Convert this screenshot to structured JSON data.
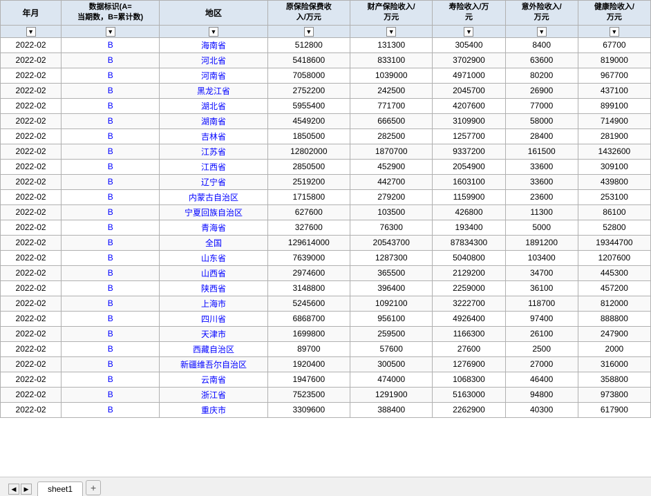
{
  "headers": {
    "year_month": "年月",
    "data_flag": "数据标识(A=当期数，B=累计数)",
    "region": "地区",
    "col1": "原保险保费收入/万元",
    "col2": "财产保险收入/万元",
    "col3": "寿险收入/万元",
    "col4": "意外险收入/万元",
    "col5": "健康险收入/万元"
  },
  "rows": [
    {
      "ym": "2022-02",
      "flag": "B",
      "region": "海南省",
      "c1": "512800",
      "c2": "131300",
      "c3": "305400",
      "c4": "8400",
      "c5": "67700"
    },
    {
      "ym": "2022-02",
      "flag": "B",
      "region": "河北省",
      "c1": "5418600",
      "c2": "833100",
      "c3": "3702900",
      "c4": "63600",
      "c5": "819000"
    },
    {
      "ym": "2022-02",
      "flag": "B",
      "region": "河南省",
      "c1": "7058000",
      "c2": "1039000",
      "c3": "4971000",
      "c4": "80200",
      "c5": "967700"
    },
    {
      "ym": "2022-02",
      "flag": "B",
      "region": "黑龙江省",
      "c1": "2752200",
      "c2": "242500",
      "c3": "2045700",
      "c4": "26900",
      "c5": "437100"
    },
    {
      "ym": "2022-02",
      "flag": "B",
      "region": "湖北省",
      "c1": "5955400",
      "c2": "771700",
      "c3": "4207600",
      "c4": "77000",
      "c5": "899100"
    },
    {
      "ym": "2022-02",
      "flag": "B",
      "region": "湖南省",
      "c1": "4549200",
      "c2": "666500",
      "c3": "3109900",
      "c4": "58000",
      "c5": "714900"
    },
    {
      "ym": "2022-02",
      "flag": "B",
      "region": "吉林省",
      "c1": "1850500",
      "c2": "282500",
      "c3": "1257700",
      "c4": "28400",
      "c5": "281900"
    },
    {
      "ym": "2022-02",
      "flag": "B",
      "region": "江苏省",
      "c1": "12802000",
      "c2": "1870700",
      "c3": "9337200",
      "c4": "161500",
      "c5": "1432600"
    },
    {
      "ym": "2022-02",
      "flag": "B",
      "region": "江西省",
      "c1": "2850500",
      "c2": "452900",
      "c3": "2054900",
      "c4": "33600",
      "c5": "309100"
    },
    {
      "ym": "2022-02",
      "flag": "B",
      "region": "辽宁省",
      "c1": "2519200",
      "c2": "442700",
      "c3": "1603100",
      "c4": "33600",
      "c5": "439800"
    },
    {
      "ym": "2022-02",
      "flag": "B",
      "region": "内蒙古自治区",
      "c1": "1715800",
      "c2": "279200",
      "c3": "1159900",
      "c4": "23600",
      "c5": "253100"
    },
    {
      "ym": "2022-02",
      "flag": "B",
      "region": "宁夏回族自治区",
      "c1": "627600",
      "c2": "103500",
      "c3": "426800",
      "c4": "11300",
      "c5": "86100"
    },
    {
      "ym": "2022-02",
      "flag": "B",
      "region": "青海省",
      "c1": "327600",
      "c2": "76300",
      "c3": "193400",
      "c4": "5000",
      "c5": "52800"
    },
    {
      "ym": "2022-02",
      "flag": "B",
      "region": "全国",
      "c1": "129614000",
      "c2": "20543700",
      "c3": "87834300",
      "c4": "1891200",
      "c5": "19344700"
    },
    {
      "ym": "2022-02",
      "flag": "B",
      "region": "山东省",
      "c1": "7639000",
      "c2": "1287300",
      "c3": "5040800",
      "c4": "103400",
      "c5": "1207600"
    },
    {
      "ym": "2022-02",
      "flag": "B",
      "region": "山西省",
      "c1": "2974600",
      "c2": "365500",
      "c3": "2129200",
      "c4": "34700",
      "c5": "445300"
    },
    {
      "ym": "2022-02",
      "flag": "B",
      "region": "陕西省",
      "c1": "3148800",
      "c2": "396400",
      "c3": "2259000",
      "c4": "36100",
      "c5": "457200"
    },
    {
      "ym": "2022-02",
      "flag": "B",
      "region": "上海市",
      "c1": "5245600",
      "c2": "1092100",
      "c3": "3222700",
      "c4": "118700",
      "c5": "812000"
    },
    {
      "ym": "2022-02",
      "flag": "B",
      "region": "四川省",
      "c1": "6868700",
      "c2": "956100",
      "c3": "4926400",
      "c4": "97400",
      "c5": "888800"
    },
    {
      "ym": "2022-02",
      "flag": "B",
      "region": "天津市",
      "c1": "1699800",
      "c2": "259500",
      "c3": "1166300",
      "c4": "26100",
      "c5": "247900"
    },
    {
      "ym": "2022-02",
      "flag": "B",
      "region": "西藏自治区",
      "c1": "89700",
      "c2": "57600",
      "c3": "27600",
      "c4": "2500",
      "c5": "2000"
    },
    {
      "ym": "2022-02",
      "flag": "B",
      "region": "新疆维吾尔自治区",
      "c1": "1920400",
      "c2": "300500",
      "c3": "1276900",
      "c4": "27000",
      "c5": "316000"
    },
    {
      "ym": "2022-02",
      "flag": "B",
      "region": "云南省",
      "c1": "1947600",
      "c2": "474000",
      "c3": "1068300",
      "c4": "46400",
      "c5": "358800"
    },
    {
      "ym": "2022-02",
      "flag": "B",
      "region": "浙江省",
      "c1": "7523500",
      "c2": "1291900",
      "c3": "5163000",
      "c4": "94800",
      "c5": "973800"
    },
    {
      "ym": "2022-02",
      "flag": "B",
      "region": "重庆市",
      "c1": "3309600",
      "c2": "388400",
      "c3": "2262900",
      "c4": "40300",
      "c5": "617900"
    }
  ],
  "sheet_tabs": [
    "sheet1"
  ],
  "add_sheet_label": "+",
  "filter_icon": "▼"
}
